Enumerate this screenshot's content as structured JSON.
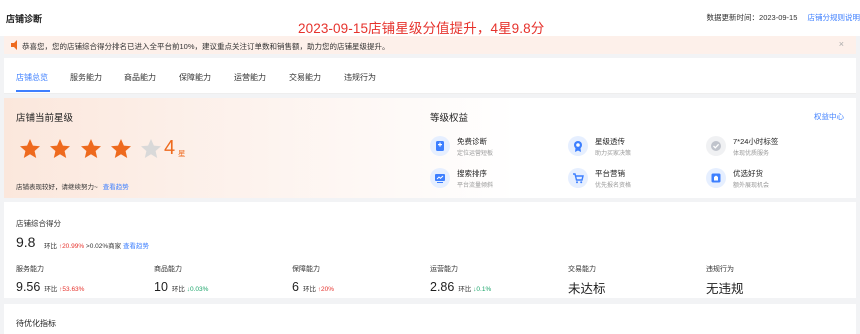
{
  "header": {
    "title": "店铺诊断",
    "overlay_caption": "2023-09-15店铺星级分值提升，4星9.8分",
    "update_prefix": "数据更新时间：",
    "update_date": "2023-09-15",
    "rules_link": "店铺分规则说明"
  },
  "notice": {
    "text": "恭喜您，您的店铺综合得分排名已进入全平台前10%，建议重点关注订单数和销售额，助力您的店铺星级提升。",
    "close": "×"
  },
  "tabs": [
    {
      "label": "店铺总览",
      "active": true
    },
    {
      "label": "服务能力"
    },
    {
      "label": "商品能力"
    },
    {
      "label": "保障能力"
    },
    {
      "label": "运营能力"
    },
    {
      "label": "交易能力"
    },
    {
      "label": "违规行为"
    }
  ],
  "star_panel": {
    "title": "店铺当前星级",
    "star_count": "4",
    "star_unit": "星",
    "stars_filled": 4,
    "stars_total": 5,
    "note": "店铺表现较好，请继续努力~",
    "note_link": "查看趋势"
  },
  "rights": {
    "title": "等级权益",
    "center_link": "权益中心",
    "items": [
      {
        "name": "免费诊断",
        "desc": "定位运营短板",
        "icon": "stethoscope-icon",
        "color": "#3d7fff",
        "bg": "#e6efff"
      },
      {
        "name": "星级透传",
        "desc": "助力买家决策",
        "icon": "badge-icon",
        "color": "#3d7fff",
        "bg": "#e6efff"
      },
      {
        "name": "7*24小时标签",
        "desc": "体现优质服务",
        "icon": "check-circle-icon",
        "color": "#c0c4cc",
        "bg": "#f0f1f3"
      },
      {
        "name": "搜索排序",
        "desc": "平台流量倾斜",
        "icon": "search-rank-icon",
        "color": "#3d7fff",
        "bg": "#e6efff"
      },
      {
        "name": "平台营销",
        "desc": "优先报名资格",
        "icon": "cart-icon",
        "color": "#3d7fff",
        "bg": "#e6efff"
      },
      {
        "name": "优选好货",
        "desc": "额外展现机会",
        "icon": "goods-icon",
        "color": "#3d7fff",
        "bg": "#e6efff"
      }
    ]
  },
  "scores": {
    "label": "店铺综合得分",
    "overall": "9.8",
    "overall_cmp_label": "环比",
    "overall_cmp_value": "20.99%",
    "overall_rank": ">0.02%商家",
    "overall_link": "查看趋势",
    "metrics": [
      {
        "label": "服务能力",
        "value": "9.56",
        "cmp_label": "环比",
        "cmp": "53.63%",
        "dir": "up"
      },
      {
        "label": "商品能力",
        "value": "10",
        "cmp_label": "环比",
        "cmp": "0.03%",
        "dir": "down"
      },
      {
        "label": "保障能力",
        "value": "6",
        "cmp_label": "环比",
        "cmp": "20%",
        "dir": "up"
      },
      {
        "label": "运营能力",
        "value": "2.86",
        "cmp_label": "环比",
        "cmp": "0.1%",
        "dir": "down"
      },
      {
        "label": "交易能力",
        "value": "未达标",
        "cmp_label": "",
        "cmp": "",
        "dir": ""
      },
      {
        "label": "违规行为",
        "value": "无违规",
        "cmp_label": "",
        "cmp": "",
        "dir": ""
      }
    ]
  },
  "pending": {
    "title": "待优化指标"
  },
  "colors": {
    "accent": "#3d7fff",
    "star": "#ee6a1e",
    "star_empty": "#d9d9d9",
    "up": "#e6322c",
    "down": "#1ba56a"
  }
}
